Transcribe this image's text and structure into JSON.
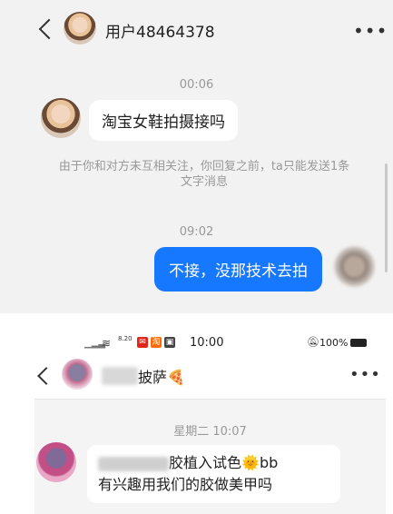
{
  "top_chat": {
    "contact_name": "用户48464378",
    "messages": [
      {
        "type": "time",
        "text": "00:06"
      },
      {
        "type": "incoming",
        "text": "淘宝女鞋拍摄接吗"
      },
      {
        "type": "notice",
        "text": "由于你和对方未互相关注，你回复之前，ta只能发送1条文字消息"
      },
      {
        "type": "time",
        "text": "09:02"
      },
      {
        "type": "outgoing",
        "text": "不接，没那技术去拍"
      }
    ]
  },
  "bottom_screenshot": {
    "status_bar": {
      "time": "10:00",
      "battery": "100%",
      "speed": "8.20"
    },
    "contact_name_visible": "披萨",
    "contact_emoji": "🍕",
    "time_label": "星期二 10:07",
    "message_line1_visible": "胶植入试色",
    "message_line1_suffix": "bb",
    "message_line2": "有兴趣用我们的胶做美甲吗",
    "sun_emoji": "🌞"
  },
  "icons": [
    "back-icon",
    "more-icon",
    "wifi-icon",
    "signal-icon",
    "mute-icon",
    "battery-icon"
  ]
}
